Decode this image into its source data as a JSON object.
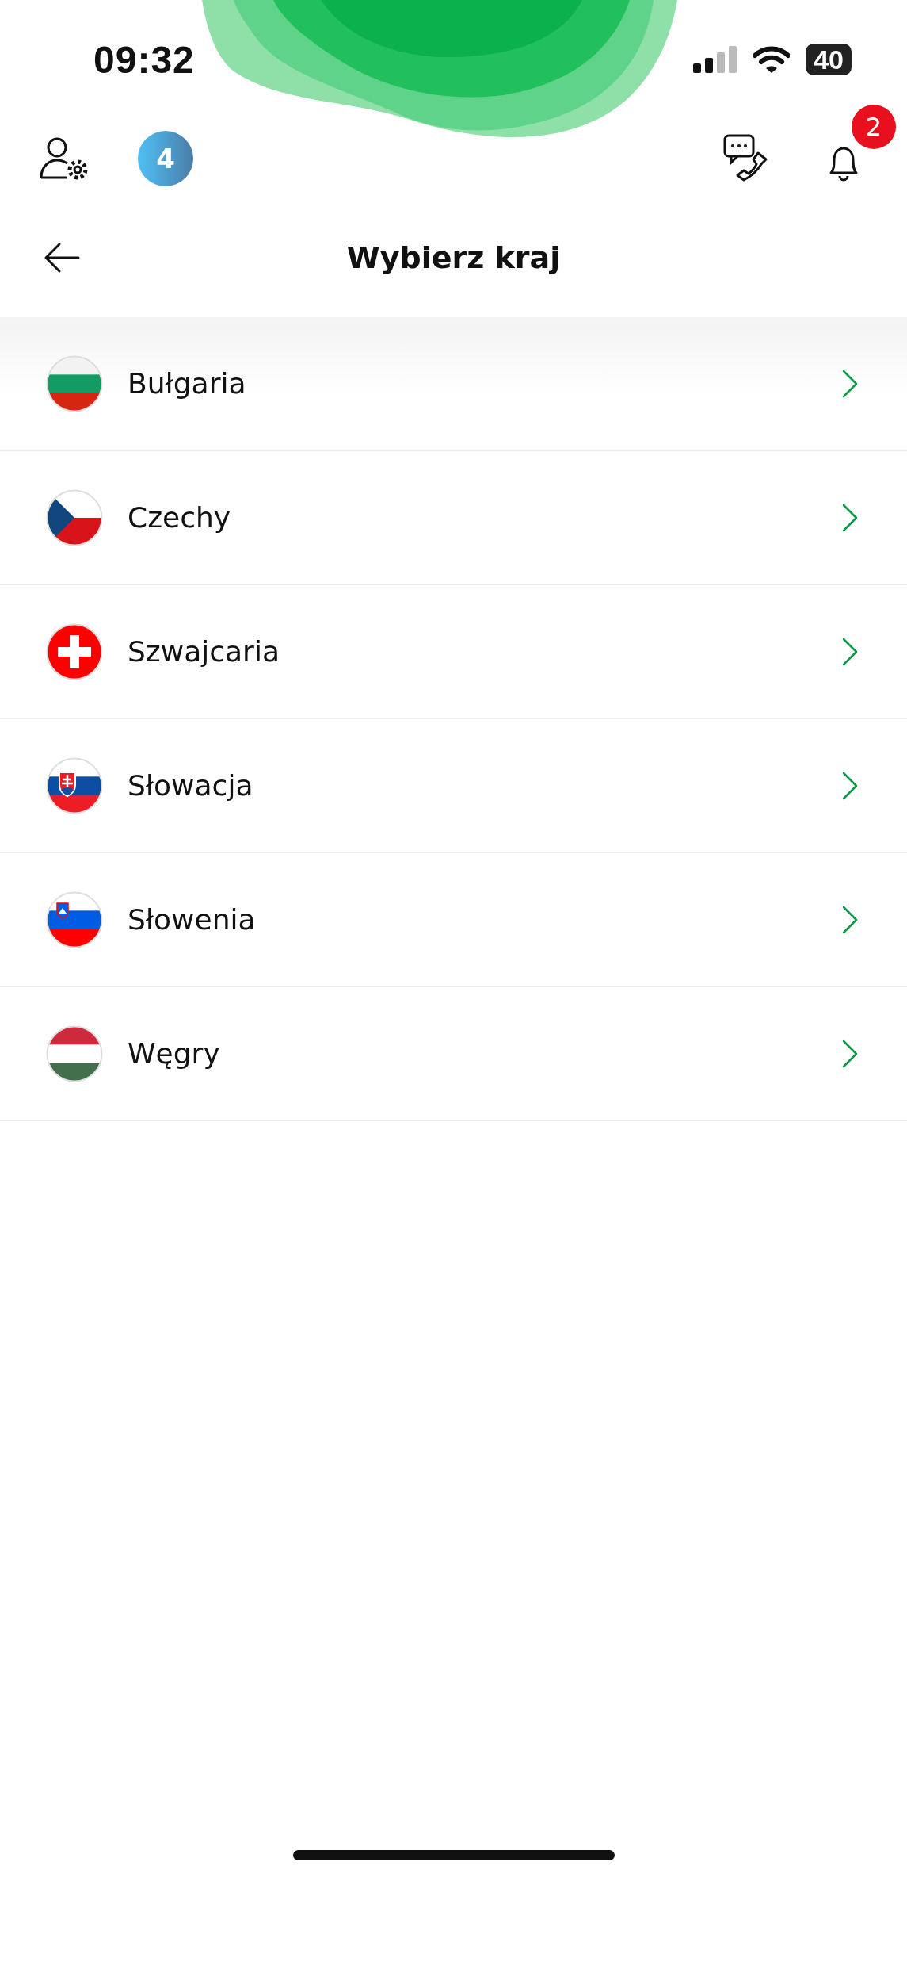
{
  "status_bar": {
    "time": "09:32",
    "battery": "40"
  },
  "top_bar": {
    "counter_badge": "4",
    "notification_badge": "2"
  },
  "header": {
    "title": "Wybierz kraj"
  },
  "countries": [
    {
      "name": "Bułgaria",
      "kind": "bg"
    },
    {
      "name": "Czechy",
      "kind": "cz"
    },
    {
      "name": "Szwajcaria",
      "kind": "ch"
    },
    {
      "name": "Słowacja",
      "kind": "sk"
    },
    {
      "name": "Słowenia",
      "kind": "si"
    },
    {
      "name": "Węgry",
      "kind": "hu"
    }
  ]
}
